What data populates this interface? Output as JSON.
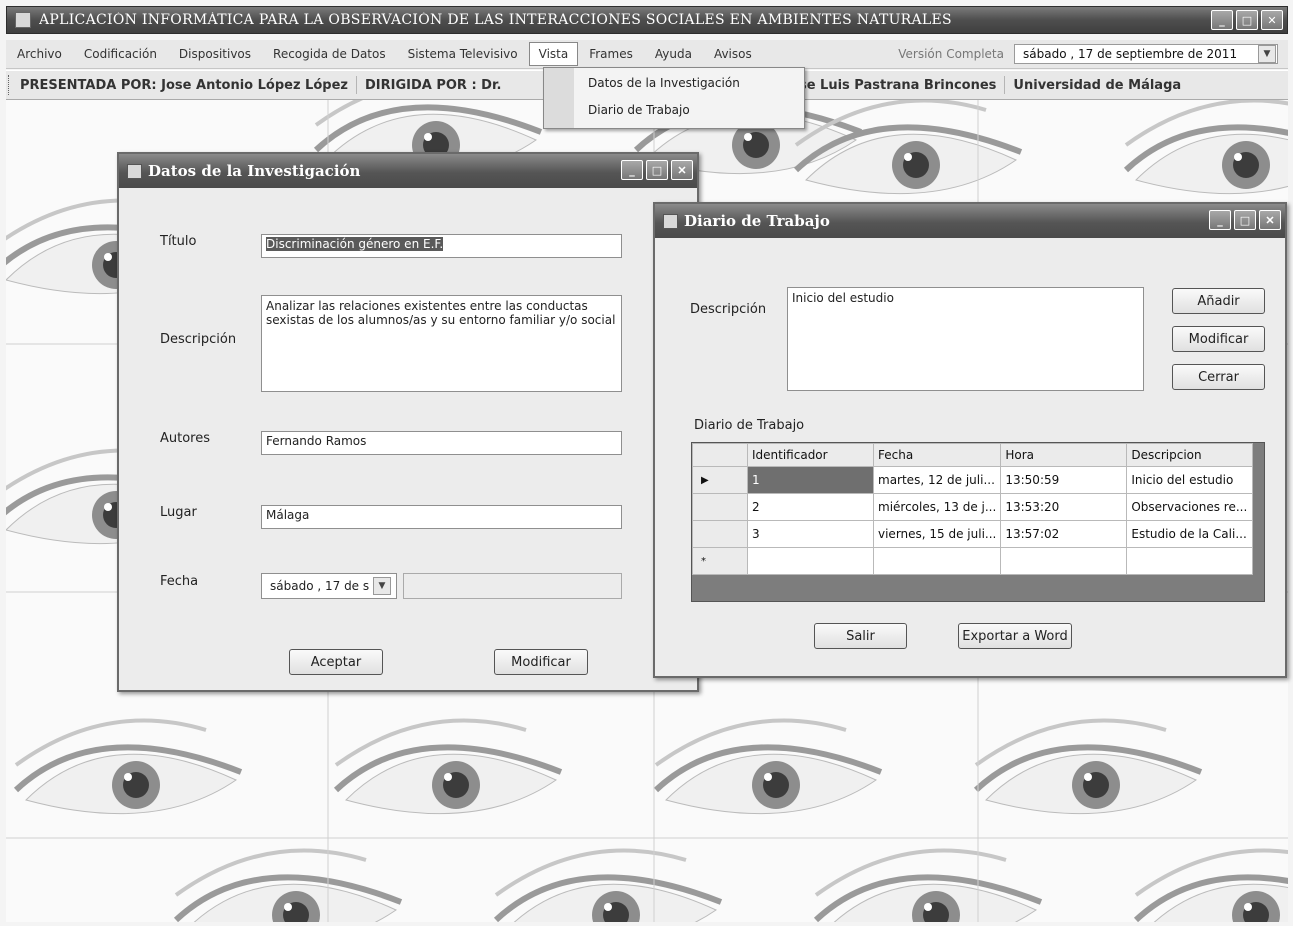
{
  "app": {
    "title": "APLICACIÓN INFORMÁTICA PARA LA OBSERVACIÓN DE LAS INTERACCIONES SOCIALES EN AMBIENTES NATURALES",
    "window_buttons": [
      "_",
      "□",
      "✕"
    ]
  },
  "menu": {
    "items": [
      "Archivo",
      "Codificación",
      "Dispositivos",
      "Recogida de Datos",
      "Sistema Televisivo",
      "Vista",
      "Frames",
      "Ayuda",
      "Avisos"
    ],
    "version": "Versión Completa",
    "date": "sábado , 17 de septiembre de 2011"
  },
  "credits": {
    "presented": "PRESENTADA POR: Jose Antonio López López",
    "directed": "DIRIGIDA POR : Dr.",
    "directed2": ". D. Jose Luis Pastrana Brincones",
    "university": "Universidad de Málaga"
  },
  "vista_menu": {
    "items": [
      "Datos de la Investigación",
      "Diario de Trabajo"
    ]
  },
  "datos_window": {
    "title": "Datos de la Investigación",
    "titulo_label": "Título",
    "titulo_value": "Discriminación género en E.F.",
    "descripcion_label": "Descripción",
    "descripcion_value": "Analizar las relaciones existentes entre las conductas sexistas de los alumnos/as y su entorno familiar y/o social",
    "autores_label": "Autores",
    "autores_value": "Fernando Ramos",
    "lugar_label": "Lugar",
    "lugar_value": "Málaga",
    "fecha_label": "Fecha",
    "fecha_value": "sábado , 17 de s",
    "aceptar": "Aceptar",
    "modificar": "Modificar"
  },
  "diario_window": {
    "title": "Diario de Trabajo",
    "descripcion_label": "Descripción",
    "descripcion_value": "Inicio del estudio",
    "anadir": "Añadir",
    "modificar": "Modificar",
    "cerrar": "Cerrar",
    "grid_label": "Diario de Trabajo",
    "columns": [
      "Identificador",
      "Fecha",
      "Hora",
      "Descripcion"
    ],
    "rows": [
      [
        "1",
        "martes, 12 de juli...",
        "13:50:59",
        "Inicio del estudio"
      ],
      [
        "2",
        "miércoles, 13 de j...",
        "13:53:20",
        "Observaciones re..."
      ],
      [
        "3",
        "viernes, 15 de juli...",
        "13:57:02",
        "Estudio de la Cali..."
      ]
    ],
    "row_marker": "▶",
    "new_marker": "*",
    "salir": "Salir",
    "exportar": "Exportar a Word"
  }
}
